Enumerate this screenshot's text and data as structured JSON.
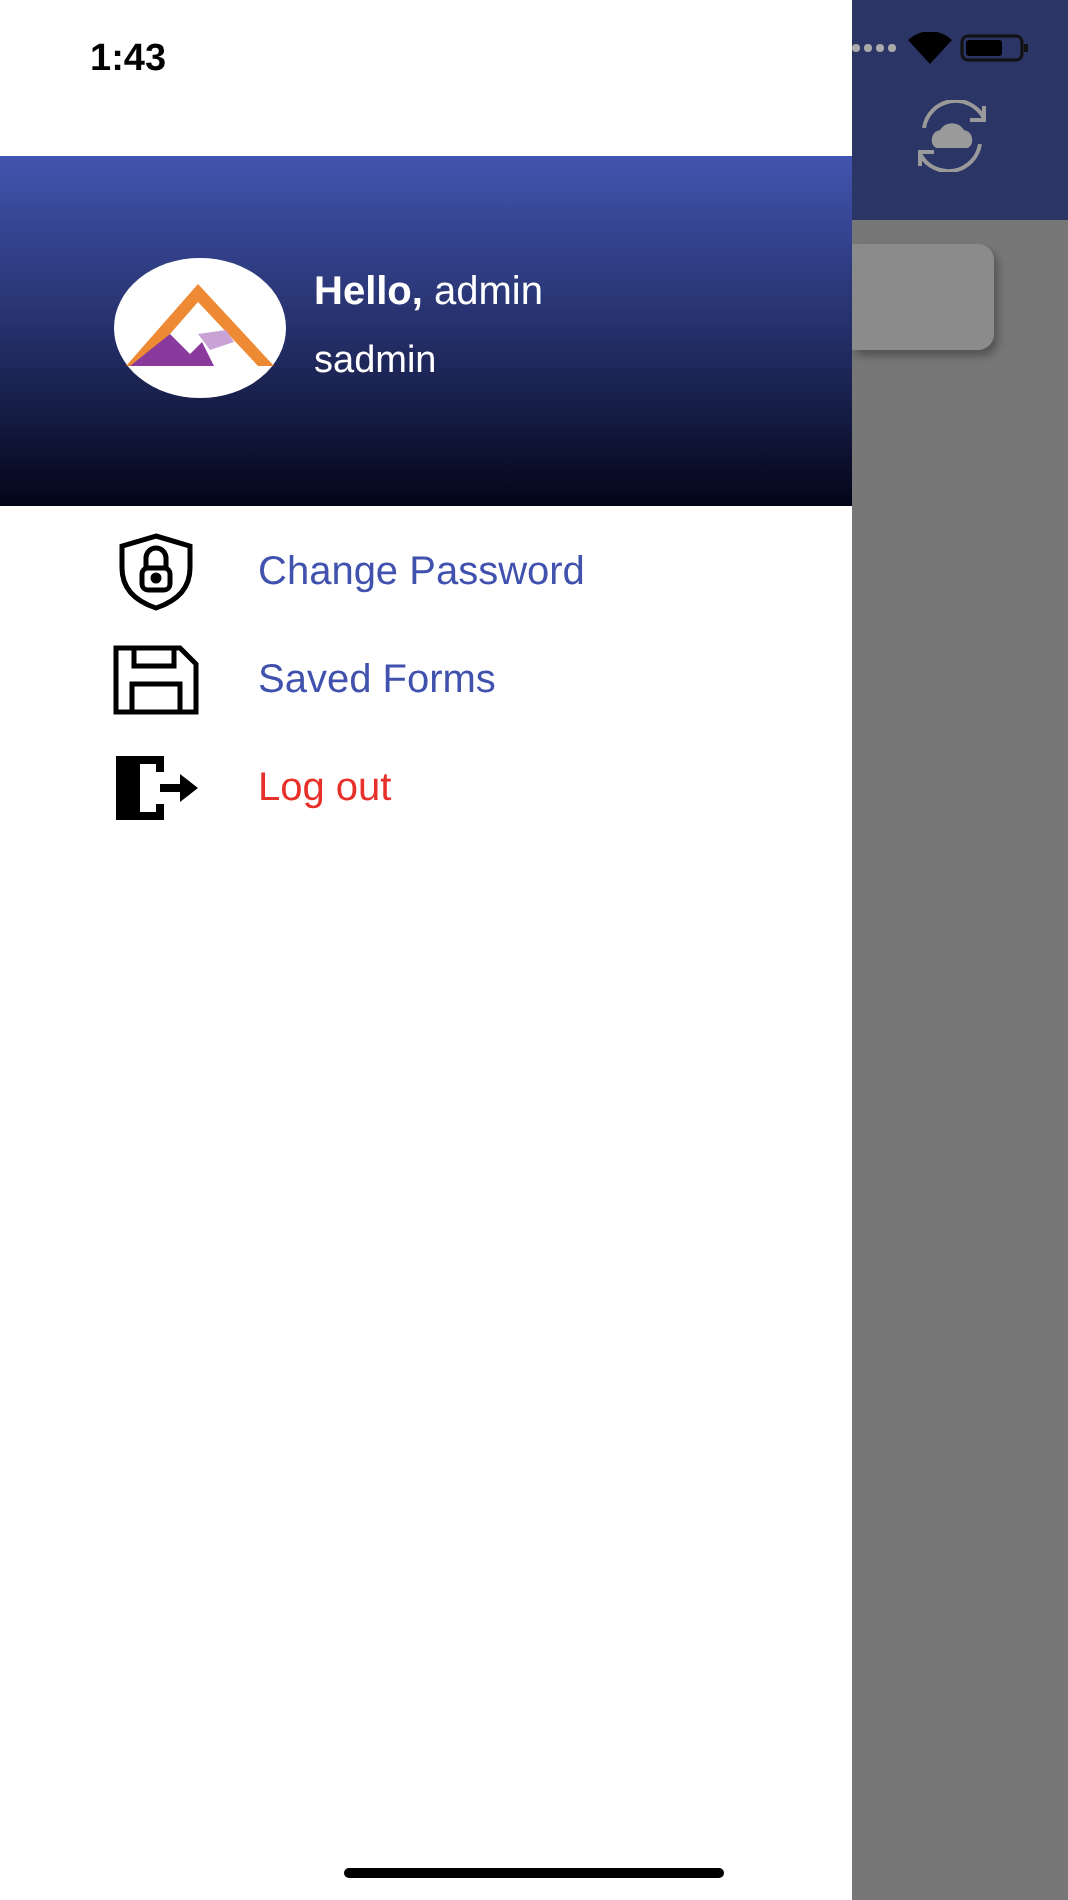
{
  "status_bar": {
    "time": "1:43"
  },
  "drawer": {
    "greeting": "**Hello,** admin",
    "username": "sadmin",
    "items": [
      {
        "kind": "password",
        "label": "Change Password"
      },
      {
        "kind": "forms",
        "label": "Saved Forms"
      },
      {
        "kind": "logout",
        "label": "Log out"
      }
    ]
  }
}
